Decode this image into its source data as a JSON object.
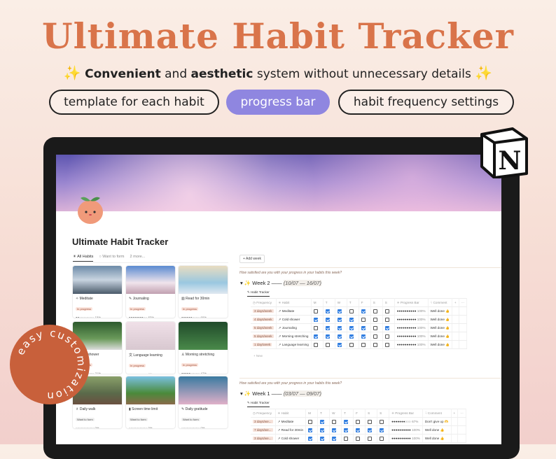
{
  "headline": "Ultimate Habit Tracker",
  "subtitle": {
    "bold1": "Convenient",
    "and": " and ",
    "bold2": "aesthetic",
    "rest": " system without unnecessary details",
    "icon": "sparkles-icon"
  },
  "pills": [
    "template for each habit",
    "progress bar",
    "habit frequency settings"
  ],
  "colors": {
    "accent": "#d9744a",
    "pill_highlight": "#8f86e0",
    "checkbox": "#2f7de1",
    "badge": "#c8603b"
  },
  "badge_text": "easy customization",
  "notion_logo": "N",
  "page": {
    "title": "Ultimate Habit Tracker",
    "tabs": [
      "☀ All Habits",
      "○ Want to form",
      "2 more..."
    ],
    "cards": [
      {
        "icon": "✧",
        "name": "Meditate",
        "status": "In progress",
        "pct": 15
      },
      {
        "icon": "✎",
        "name": "Journaling",
        "status": "In progress",
        "pct": 83
      },
      {
        "icon": "▥",
        "name": "Read for 30min",
        "status": "In progress",
        "pct": 60
      },
      {
        "icon": "✧",
        "name": "Cold shower",
        "status": "In progress",
        "pct": 21
      },
      {
        "icon": "文",
        "name": "Language learning",
        "status": "In progress",
        "pct": 4
      },
      {
        "icon": "♙",
        "name": "Morning stretching",
        "status": "In progress",
        "pct": 47
      },
      {
        "icon": "♗",
        "name": "Daily walk",
        "status": "Want to form",
        "pct": 0
      },
      {
        "icon": "▮",
        "name": "Screen time limit",
        "status": "Want to form",
        "pct": 0
      },
      {
        "icon": "✎",
        "name": "Daily gratitude",
        "status": "Want to form",
        "pct": 0
      }
    ],
    "add_week": "+ Add week",
    "question": "How satisfied are you with your progress in your habits this week?",
    "view_tab": "✎ Habit Tracker",
    "columns": [
      "◷ Frequency",
      "✳ Habit",
      "M",
      "T",
      "W",
      "T",
      "F",
      "S",
      "S",
      "✳ Progress Bar",
      "☟ Comment",
      "+",
      "···"
    ],
    "new_label": "+ New",
    "weeks": [
      {
        "title": "Week 2 ——",
        "dates": "(10/07 — 16/07)",
        "rows": [
          {
            "freq": "3 days/week",
            "habit": "Meditate",
            "days": [
              0,
              1,
              1,
              0,
              1,
              0,
              0
            ],
            "pct": "100%",
            "comment": "Well done 👍"
          },
          {
            "freq": "4 days/week",
            "habit": "Cold shower",
            "days": [
              1,
              1,
              1,
              1,
              0,
              0,
              0
            ],
            "pct": "100%",
            "comment": "Well done 👍"
          },
          {
            "freq": "5 days/week",
            "habit": "Journaling",
            "days": [
              0,
              1,
              1,
              1,
              1,
              0,
              1
            ],
            "pct": "100%",
            "comment": "Well done 👍"
          },
          {
            "freq": "5 days/week",
            "habit": "Morning stretching",
            "days": [
              1,
              1,
              1,
              1,
              1,
              0,
              0
            ],
            "pct": "100%",
            "comment": "Well done 👍"
          },
          {
            "freq": "1 day/week",
            "habit": "Language learning",
            "days": [
              0,
              0,
              1,
              0,
              0,
              0,
              0
            ],
            "pct": "100%",
            "comment": "Well done 👍"
          }
        ]
      },
      {
        "title": "Week 1 ——",
        "dates": "(03/07 — 09/07)",
        "rows": [
          {
            "freq": "3 days/we...",
            "habit": "Meditate",
            "days": [
              0,
              1,
              0,
              1,
              0,
              0,
              0
            ],
            "pct": "67%",
            "comment": "Don't give up 🫶"
          },
          {
            "freq": "7 days/we...",
            "habit": "Read for 30min",
            "days": [
              1,
              1,
              1,
              1,
              1,
              1,
              1
            ],
            "pct": "100%",
            "comment": "Well done 👍"
          },
          {
            "freq": "3 days/we...",
            "habit": "Cold shower",
            "days": [
              1,
              1,
              1,
              0,
              0,
              0,
              0
            ],
            "pct": "100%",
            "comment": "Well done 👍"
          }
        ]
      }
    ]
  }
}
